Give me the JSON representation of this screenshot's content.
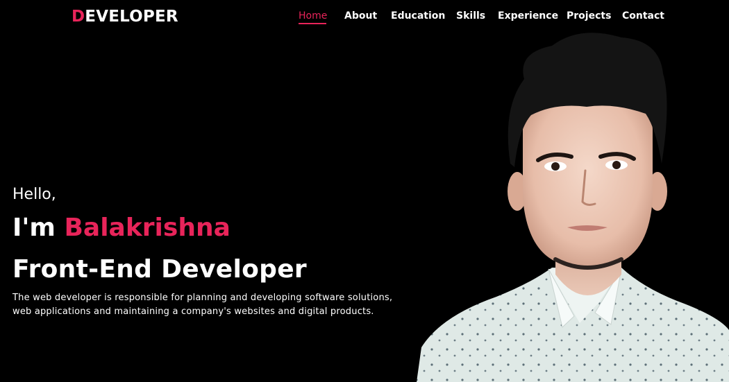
{
  "theme": {
    "accent": "#e8245a",
    "background": "#000000"
  },
  "logo": {
    "first_letter": "D",
    "rest": "EVELOPER"
  },
  "nav": {
    "items": [
      {
        "label": "Home",
        "active": true
      },
      {
        "label": "About"
      },
      {
        "label": "Education"
      },
      {
        "label": "Skills"
      },
      {
        "label": "Experience"
      },
      {
        "label": "Projects"
      },
      {
        "label": "Contact"
      }
    ]
  },
  "hero": {
    "greeting": "Hello,",
    "intro": "I'm",
    "name": "Balakrishna",
    "role": "Front-End Developer",
    "description_line1": "The web developer is responsible for planning and developing software solutions,",
    "description_line2": "web applications and maintaining a company's websites and digital products."
  },
  "portrait": {
    "icon": "person-photo"
  }
}
